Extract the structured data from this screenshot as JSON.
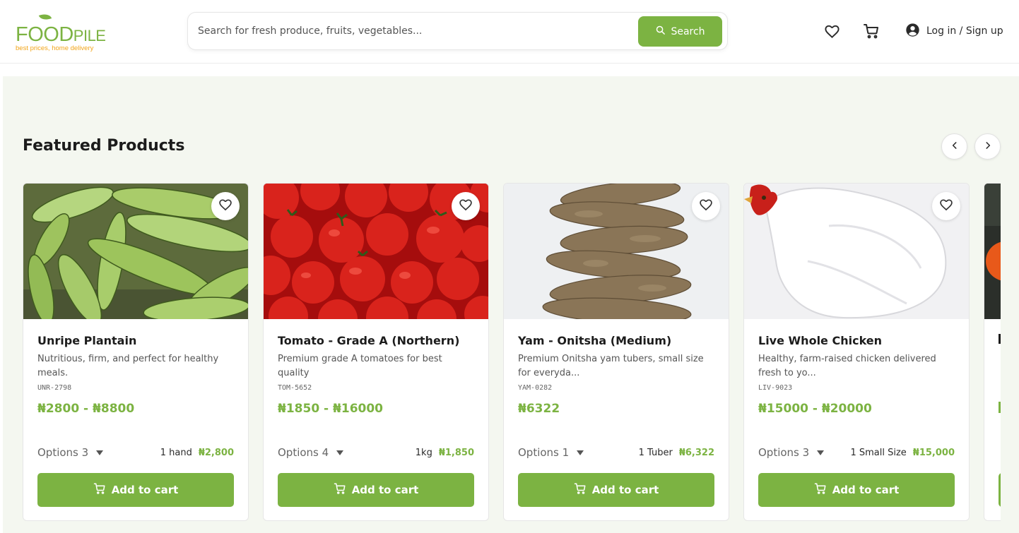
{
  "brand": {
    "name_main": "FOOD",
    "name_suffix": "PILE",
    "tagline": "best prices, home delivery",
    "accent": "#7cb342",
    "secondary": "#f2a51a"
  },
  "header": {
    "search": {
      "placeholder": "Search for fresh produce, fruits, vegetables...",
      "value": "",
      "button_label": "Search",
      "icon": "search-icon"
    },
    "icons": [
      "heart-icon",
      "cart-icon"
    ],
    "login_label": "Log in / Sign up"
  },
  "featured": {
    "title": "Featured Products",
    "products": [
      {
        "name": "Unripe Plantain",
        "description": "Nutritious, firm, and perfect for healthy meals.",
        "sku": "UNR-2798",
        "price_range": "₦2800 - ₦8800",
        "options_label": "Options 3",
        "unit": "1 hand",
        "unit_price": "₦2,800",
        "add_label": "Add to cart"
      },
      {
        "name": "Tomato - Grade A (Northern)",
        "description": "Premium grade A tomatoes for best quality",
        "sku": "TOM-5652",
        "price_range": "₦1850 - ₦16000",
        "options_label": "Options 4",
        "unit": "1kg",
        "unit_price": "₦1,850",
        "add_label": "Add to cart"
      },
      {
        "name": "Yam - Onitsha (Medium)",
        "description": "Premium Onitsha yam tubers, small size for everyda...",
        "sku": "YAM-0282",
        "price_range": "₦6322",
        "options_label": "Options 1",
        "unit": "1 Tuber",
        "unit_price": "₦6,322",
        "add_label": "Add to cart"
      },
      {
        "name": "Live Whole Chicken",
        "description": "Healthy, farm-raised chicken delivered fresh to yo...",
        "sku": "LIV-9023",
        "price_range": "₦15000 - ₦20000",
        "options_label": "Options 3",
        "unit": "1 Small Size",
        "unit_price": "₦15,000",
        "add_label": "Add to cart"
      }
    ]
  }
}
